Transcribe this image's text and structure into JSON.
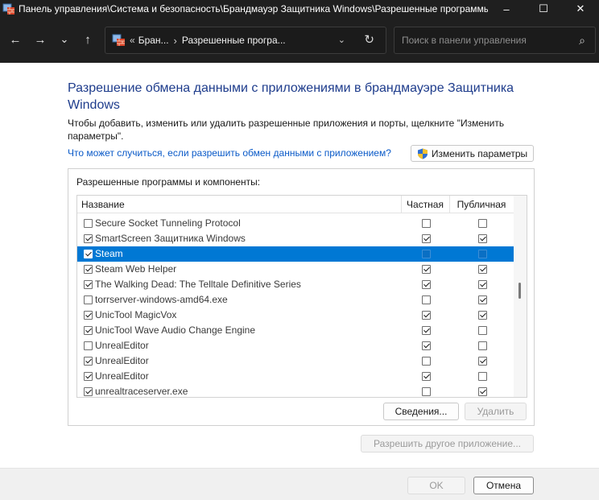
{
  "window": {
    "title": "Панель управления\\Система и безопасность\\Брандмауэр Защитника Windows\\Разрешенные программы",
    "minimize_glyph": "–",
    "maximize_glyph": "☐",
    "close_glyph": "✕"
  },
  "nav": {
    "back_glyph": "←",
    "forward_glyph": "→",
    "history_glyph": "⌄",
    "up_glyph": "↑",
    "address": {
      "overflow": "«",
      "crumb1": "Бран...",
      "separator": "›",
      "crumb2": "Разрешенные програ...",
      "dropdown_glyph": "⌄",
      "refresh_glyph": "↻"
    },
    "search": {
      "placeholder": "Поиск в панели управления",
      "glyph": "⌕"
    }
  },
  "main": {
    "heading": "Разрешение обмена данными с приложениями в брандмауэре Защитника Windows",
    "description": "Чтобы добавить, изменить или удалить разрешенные приложения и порты, щелкните \"Изменить параметры\".",
    "risk_link": "Что может случиться, если разрешить обмен данными с приложением?",
    "change_settings_label": "Изменить параметры"
  },
  "panel": {
    "label": "Разрешенные программы и компоненты:",
    "columns": {
      "name": "Название",
      "private": "Частная",
      "public": "Публичная"
    },
    "rows": [
      {
        "name": "Secure Socket Tunneling Protocol",
        "enabled": false,
        "private": false,
        "public": false,
        "selected": false
      },
      {
        "name": "SmartScreen Защитника Windows",
        "enabled": true,
        "private": true,
        "public": true,
        "selected": false
      },
      {
        "name": "Steam",
        "enabled": true,
        "private": false,
        "public": false,
        "selected": true
      },
      {
        "name": "Steam Web Helper",
        "enabled": true,
        "private": true,
        "public": true,
        "selected": false
      },
      {
        "name": "The Walking Dead: The Telltale Definitive Series",
        "enabled": true,
        "private": true,
        "public": true,
        "selected": false
      },
      {
        "name": "torrserver-windows-amd64.exe",
        "enabled": false,
        "private": false,
        "public": true,
        "selected": false
      },
      {
        "name": "UnicTool MagicVox",
        "enabled": true,
        "private": true,
        "public": true,
        "selected": false
      },
      {
        "name": "UnicTool Wave Audio Change Engine",
        "enabled": true,
        "private": true,
        "public": false,
        "selected": false
      },
      {
        "name": "UnrealEditor",
        "enabled": false,
        "private": true,
        "public": false,
        "selected": false
      },
      {
        "name": "UnrealEditor",
        "enabled": true,
        "private": false,
        "public": true,
        "selected": false
      },
      {
        "name": "UnrealEditor",
        "enabled": true,
        "private": true,
        "public": false,
        "selected": false
      },
      {
        "name": "unrealtraceserver.exe",
        "enabled": true,
        "private": false,
        "public": true,
        "selected": false
      }
    ],
    "details_label": "Сведения...",
    "remove_label": "Удалить"
  },
  "allow_other_label": "Разрешить другое приложение...",
  "footer": {
    "ok_label": "OK",
    "cancel_label": "Отмена"
  },
  "colors": {
    "heading": "#1e3c8c",
    "link": "#0a5ac8",
    "selection": "#0078d4",
    "titlebar": "#1f1f1f"
  }
}
